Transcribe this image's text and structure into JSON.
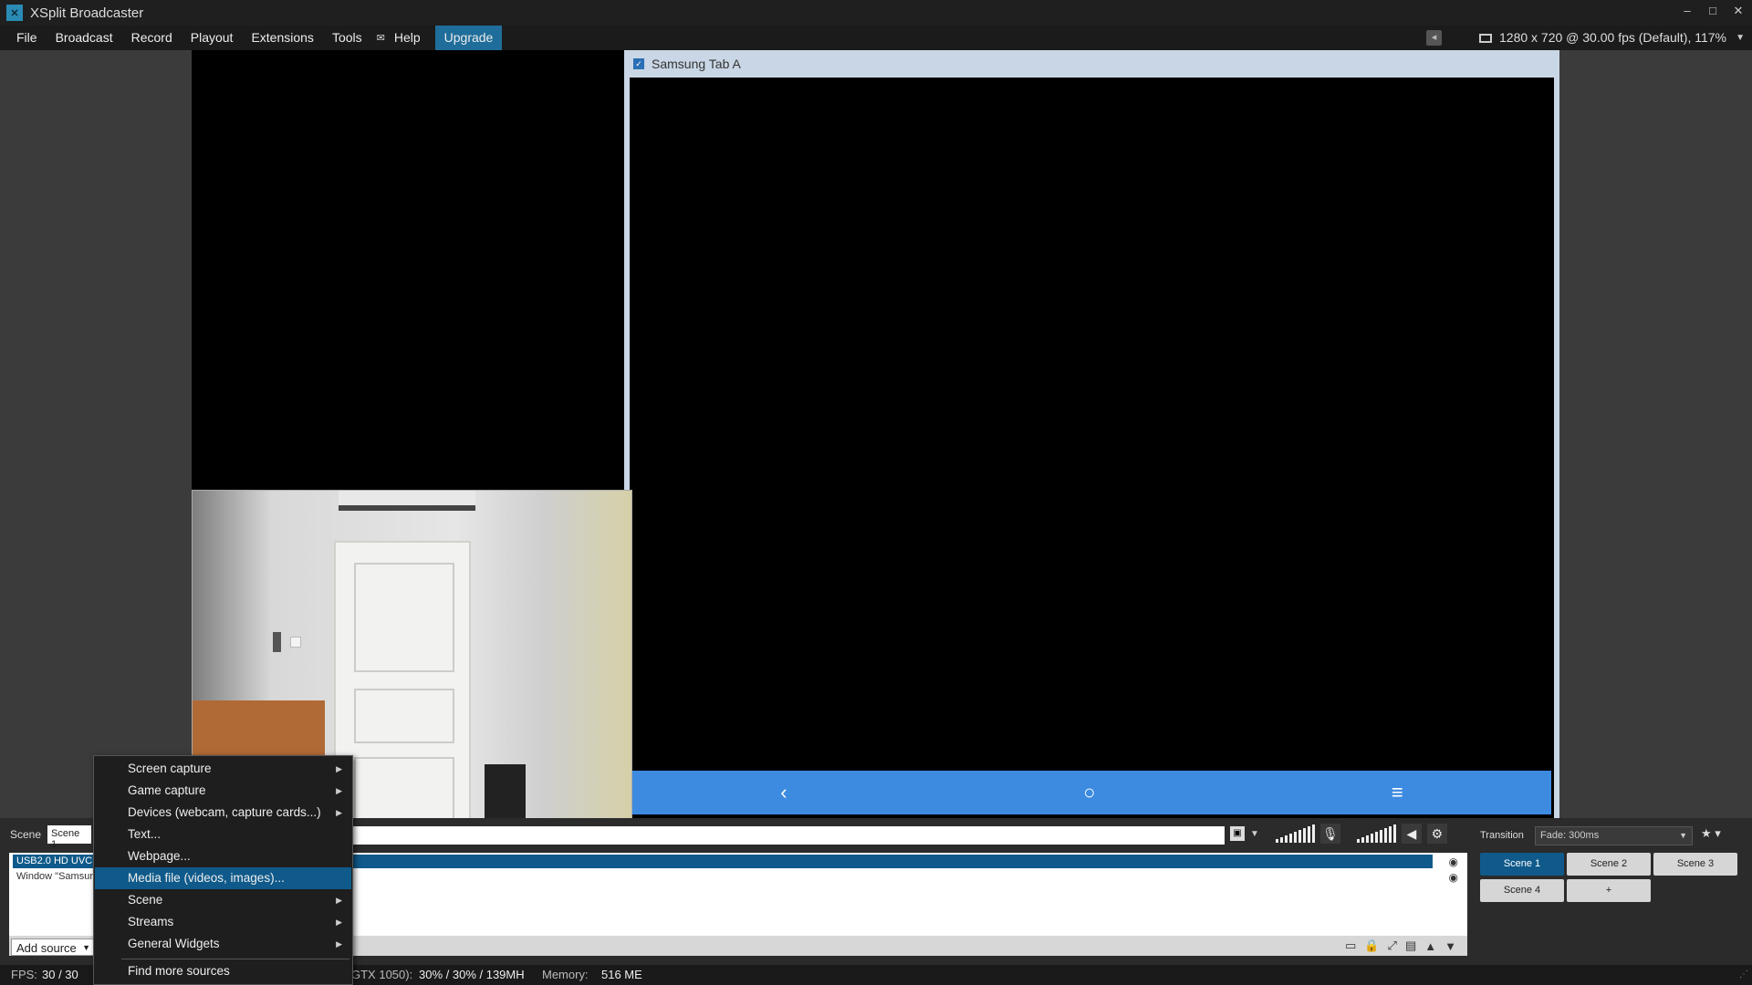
{
  "titlebar": {
    "title": "XSplit Broadcaster",
    "minimize": "–",
    "maximize": "□",
    "close": "✕"
  },
  "menu": {
    "items": [
      "File",
      "Broadcast",
      "Record",
      "Playout",
      "Extensions",
      "Tools",
      "Help",
      "Upgrade"
    ]
  },
  "resolution": "1280 x 720 @ 30.00 fps (Default), 117%",
  "preview": {
    "window_title": "Samsung Tab A",
    "nav": {
      "back": "‹",
      "home": "○",
      "menu": "≡"
    }
  },
  "scene_bar": {
    "label": "Scene",
    "value": "Scene 1"
  },
  "sources": [
    {
      "name": "USB2.0 HD UVC W",
      "selected": true
    },
    {
      "name": "Window \"Samsun",
      "selected": false
    }
  ],
  "add_source_label": "Add source",
  "transition": {
    "label": "Transition",
    "value": "Fade: 300ms"
  },
  "scenes": [
    "Scene 1",
    "Scene 2",
    "Scene 3",
    "Scene 4",
    "+"
  ],
  "active_scene": "Scene 1",
  "context_menu": [
    {
      "label": "Screen capture",
      "submenu": true
    },
    {
      "label": "Game capture",
      "submenu": true
    },
    {
      "label": "Devices (webcam, capture cards...)",
      "submenu": true
    },
    {
      "label": "Text...",
      "submenu": false
    },
    {
      "label": "Webpage...",
      "submenu": false
    },
    {
      "label": "Media file (videos, images)...",
      "submenu": false,
      "highlighted": true
    },
    {
      "label": "Scene",
      "submenu": true
    },
    {
      "label": "Streams",
      "submenu": true
    },
    {
      "label": "General Widgets",
      "submenu": true
    },
    {
      "label": "Find more sources",
      "submenu": false
    }
  ],
  "status": {
    "fps_label": "FPS:",
    "fps_value": "30 / 30",
    "gpu_label": "GTX 1050):",
    "gpu_value": "30% / 30% / 139MH",
    "mem_label": "Memory:",
    "mem_value": "516 ME"
  }
}
